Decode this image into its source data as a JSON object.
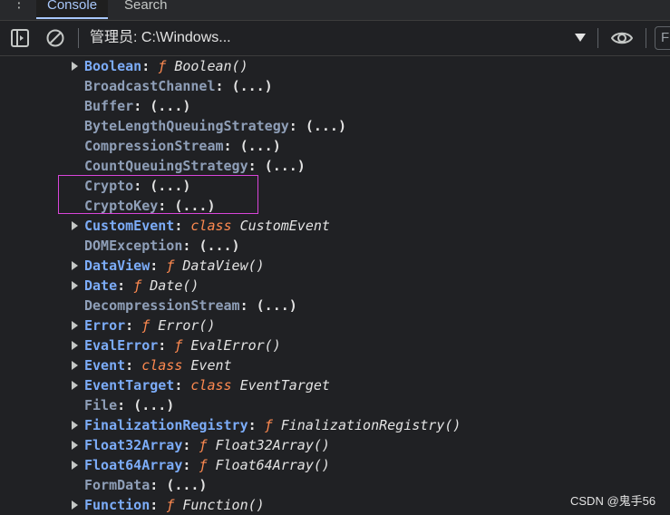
{
  "tabs": [
    {
      "label": "Console",
      "active": true
    },
    {
      "label": "Search",
      "active": false
    }
  ],
  "toolbar": {
    "context_label": "管理员: C:\\Windows...",
    "filter_placeholder": "Fi"
  },
  "tree_items": [
    {
      "key": "Boolean",
      "expandable": true,
      "kind": "function",
      "type_label": "ƒ",
      "value": "Boolean()"
    },
    {
      "key": "BroadcastChannel",
      "expandable": false,
      "kind": "getter",
      "value": "(...)"
    },
    {
      "key": "Buffer",
      "expandable": false,
      "kind": "getter",
      "value": "(...)"
    },
    {
      "key": "ByteLengthQueuingStrategy",
      "expandable": false,
      "kind": "getter",
      "value": "(...)"
    },
    {
      "key": "CompressionStream",
      "expandable": false,
      "kind": "getter",
      "value": "(...)"
    },
    {
      "key": "CountQueuingStrategy",
      "expandable": false,
      "kind": "getter",
      "value": "(...)"
    },
    {
      "key": "Crypto",
      "expandable": false,
      "kind": "getter",
      "value": "(...)",
      "highlighted": true
    },
    {
      "key": "CryptoKey",
      "expandable": false,
      "kind": "getter",
      "value": "(...)",
      "highlighted": true
    },
    {
      "key": "CustomEvent",
      "expandable": true,
      "kind": "class",
      "type_label": "class",
      "value": "CustomEvent"
    },
    {
      "key": "DOMException",
      "expandable": false,
      "kind": "getter",
      "value": "(...)"
    },
    {
      "key": "DataView",
      "expandable": true,
      "kind": "function",
      "type_label": "ƒ",
      "value": "DataView()"
    },
    {
      "key": "Date",
      "expandable": true,
      "kind": "function",
      "type_label": "ƒ",
      "value": "Date()"
    },
    {
      "key": "DecompressionStream",
      "expandable": false,
      "kind": "getter",
      "value": "(...)"
    },
    {
      "key": "Error",
      "expandable": true,
      "kind": "function",
      "type_label": "ƒ",
      "value": "Error()"
    },
    {
      "key": "EvalError",
      "expandable": true,
      "kind": "function",
      "type_label": "ƒ",
      "value": "EvalError()"
    },
    {
      "key": "Event",
      "expandable": true,
      "kind": "class",
      "type_label": "class",
      "value": "Event"
    },
    {
      "key": "EventTarget",
      "expandable": true,
      "kind": "class",
      "type_label": "class",
      "value": "EventTarget"
    },
    {
      "key": "File",
      "expandable": false,
      "kind": "getter",
      "value": "(...)"
    },
    {
      "key": "FinalizationRegistry",
      "expandable": true,
      "kind": "function",
      "type_label": "ƒ",
      "value": "FinalizationRegistry()"
    },
    {
      "key": "Float32Array",
      "expandable": true,
      "kind": "function",
      "type_label": "ƒ",
      "value": "Float32Array()"
    },
    {
      "key": "Float64Array",
      "expandable": true,
      "kind": "function",
      "type_label": "ƒ",
      "value": "Float64Array()"
    },
    {
      "key": "FormData",
      "expandable": false,
      "kind": "getter",
      "value": "(...)"
    },
    {
      "key": "Function",
      "expandable": true,
      "kind": "function",
      "type_label": "ƒ",
      "value": "Function()"
    }
  ],
  "watermark": "CSDN @鬼手56",
  "colors": {
    "background": "#202124",
    "key": "#7cacf8",
    "keyword": "#ff8a50",
    "highlight_border": "#d945d9",
    "active_tab": "#a8c7fa"
  }
}
